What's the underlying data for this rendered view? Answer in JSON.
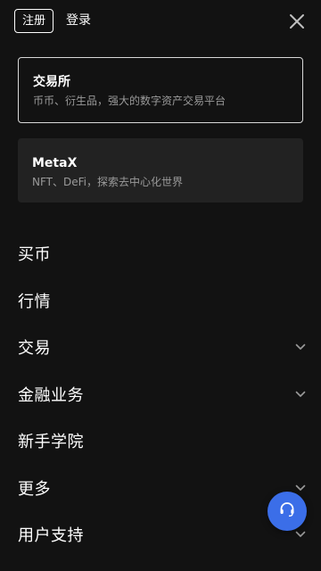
{
  "header": {
    "register_label": "注册",
    "login_label": "登录",
    "close_icon": "close-icon"
  },
  "cards": [
    {
      "title": "交易所",
      "subtitle": "币币、衍生品，强大的数字资产交易平台"
    },
    {
      "title": "MetaX",
      "subtitle": "NFT、DeFi，探索去中心化世界"
    }
  ],
  "menu": {
    "items": [
      {
        "label": "买币",
        "expandable": false
      },
      {
        "label": "行情",
        "expandable": false
      },
      {
        "label": "交易",
        "expandable": true
      },
      {
        "label": "金融业务",
        "expandable": true
      },
      {
        "label": "新手学院",
        "expandable": false
      },
      {
        "label": "更多",
        "expandable": true
      },
      {
        "label": "用户支持",
        "expandable": true
      }
    ]
  },
  "support": {
    "icon": "headset-icon"
  },
  "colors": {
    "background": "#121212",
    "card": "#222222",
    "accent": "#3b6ee8",
    "subtext": "#9a9a9a"
  }
}
